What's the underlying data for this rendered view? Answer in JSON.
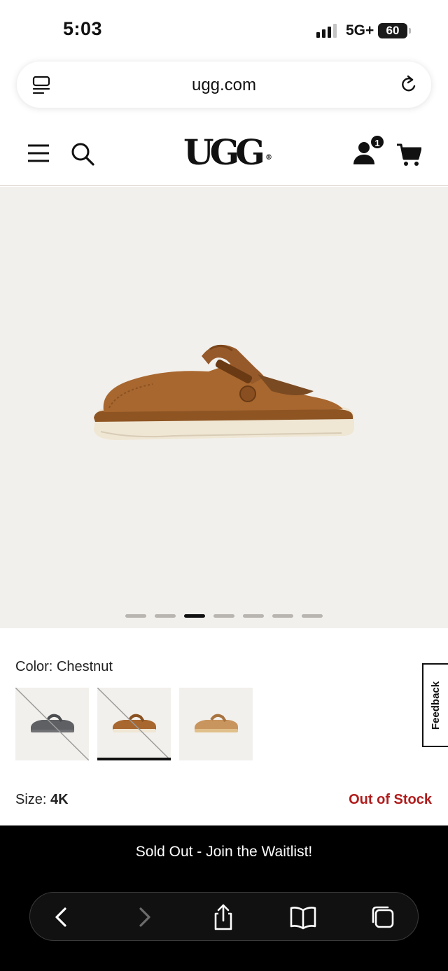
{
  "status_bar": {
    "time": "5:03",
    "network": "5G+",
    "battery": "60"
  },
  "browser": {
    "url": "ugg.com"
  },
  "header": {
    "logo": "UGG",
    "logo_mark": "®",
    "account_badge_count": "1"
  },
  "product": {
    "image_count": 7,
    "active_image_index": 2,
    "color_prefix": "Color:",
    "color_name": "Chestnut",
    "swatches": [
      {
        "name": "charcoal",
        "available": false,
        "selected": false
      },
      {
        "name": "chestnut",
        "available": false,
        "selected": true
      },
      {
        "name": "sand",
        "available": true,
        "selected": false
      }
    ],
    "size_prefix": "Size:",
    "size_value": "4K",
    "stock_status": "Out of Stock"
  },
  "feedback_label": "Feedback",
  "cta": {
    "label": "Sold Out - Join the Waitlist!"
  },
  "toolbar": {
    "icons": [
      "back-icon",
      "forward-icon",
      "share-icon",
      "bookmarks-icon",
      "tabs-icon"
    ]
  },
  "colors": {
    "accent_red": "#b01c1c",
    "media_background": "#f2f0ec",
    "suede_chestnut": "#a8672f"
  }
}
